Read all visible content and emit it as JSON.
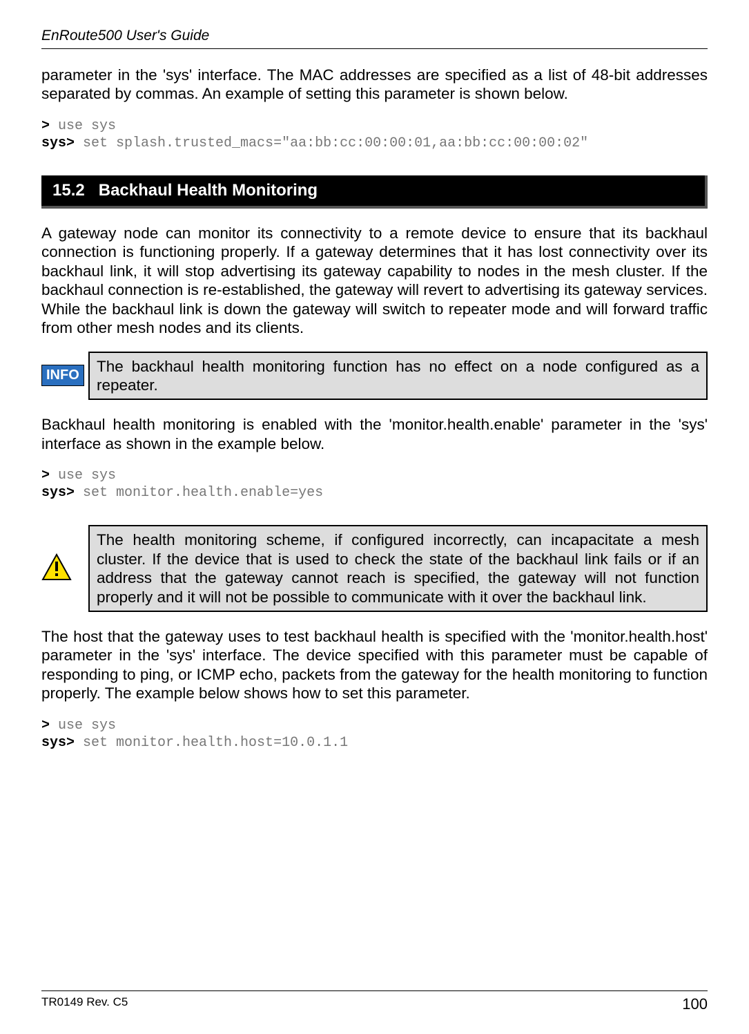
{
  "header": {
    "title": "EnRoute500 User's Guide"
  },
  "intro_paragraph": "parameter in the 'sys' interface. The MAC addresses are specified as a list of 48-bit addresses separated by commas. An example of setting this parameter is shown below.",
  "code1": {
    "line1_prompt": ">",
    "line1_cmd": " use sys",
    "line2_prompt": "sys>",
    "line2_cmd": " set splash.trusted_macs=\"aa:bb:cc:00:00:01,aa:bb:cc:00:00:02\""
  },
  "section": {
    "number": "15.2",
    "title": "Backhaul Health Monitoring"
  },
  "para1": "A gateway node can monitor its connectivity to a remote device to ensure that its backhaul connection is functioning properly. If a gateway determines that it has lost connectivity over its backhaul link, it will stop advertising its gateway capability to nodes in the mesh cluster. If the backhaul connection is re-established, the gateway will revert to advertising its gateway services. While the backhaul link is down the gateway will switch to repeater mode and will forward traffic from other mesh nodes and its clients.",
  "info_callout": {
    "badge": "INFO",
    "text": "The backhaul health monitoring function has no effect on a node configured as a repeater."
  },
  "para2": "Backhaul health monitoring is enabled with the 'monitor.health.enable' parameter in the 'sys' interface as shown in the example below.",
  "code2": {
    "line1_prompt": ">",
    "line1_cmd": " use sys",
    "line2_prompt": "sys>",
    "line2_cmd": " set monitor.health.enable=yes"
  },
  "warn_callout": {
    "text": "The health monitoring scheme, if configured incorrectly, can incapacitate a mesh cluster. If the device that is used to check the state of the backhaul link fails or if an address that the gateway cannot reach is specified, the gateway will not function properly and it will not be possible to communicate with it over the backhaul link."
  },
  "para3": "The host that the gateway uses to test backhaul health is specified with the 'monitor.health.host' parameter in the 'sys' interface. The device specified with this parameter must be capable of responding to ping, or ICMP echo, packets from the gateway for the health monitoring to function properly. The example below shows how to set this parameter.",
  "code3": {
    "line1_prompt": ">",
    "line1_cmd": " use sys",
    "line2_prompt": "sys>",
    "line2_cmd": " set monitor.health.host=10.0.1.1"
  },
  "footer": {
    "left": "TR0149 Rev. C5",
    "right": "100"
  }
}
